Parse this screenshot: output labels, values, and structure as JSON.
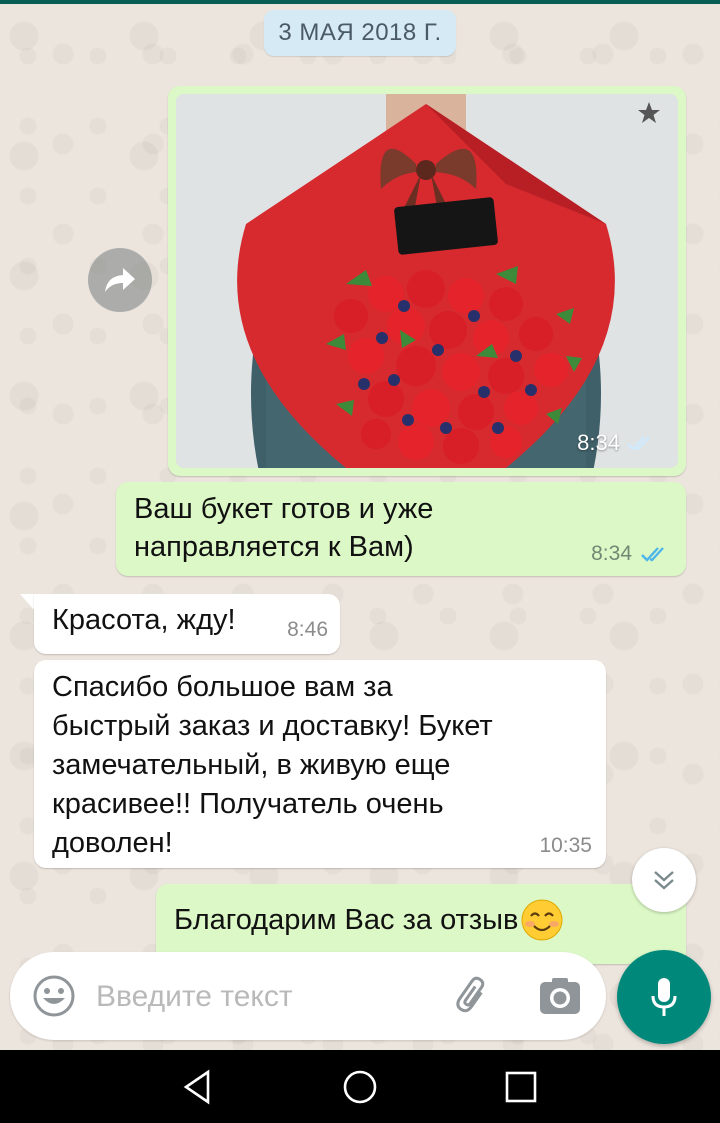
{
  "chat": {
    "date_label": "3 МАЯ 2018 Г.",
    "messages": [
      {
        "type": "image",
        "direction": "out",
        "time": "8:34",
        "status": "read"
      },
      {
        "type": "text",
        "direction": "out",
        "text_lines": [
          "Ваш букет готов и уже",
          "направляется к Вам)"
        ],
        "time": "8:34",
        "status": "read"
      },
      {
        "type": "text",
        "direction": "in",
        "text": "Красота, жду!",
        "time": "8:46"
      },
      {
        "type": "text",
        "direction": "in",
        "text_lines": [
          "Спасибо большое вам за",
          "быстрый заказ и доставку! Букет",
          "замечательный, в живую еще",
          "красивее!! Получатель очень",
          "доволен!"
        ],
        "time": "10:35"
      },
      {
        "type": "text",
        "direction": "out",
        "text": "Благодарим Вас за отзыв",
        "emoji": "smiling-face"
      }
    ]
  },
  "composer": {
    "placeholder": "Введите текст",
    "value": ""
  },
  "colors": {
    "outgoing_bubble": "#dcf8c6",
    "incoming_bubble": "#ffffff",
    "read_ticks": "#4fb6ec",
    "mic_button": "#00897b",
    "date_pill": "#d5eaf5"
  },
  "icons": [
    "forward-icon",
    "star-icon",
    "double-check-icon",
    "chevron-down-icon",
    "emoji-icon",
    "attach-icon",
    "camera-icon",
    "mic-icon",
    "back-icon",
    "home-icon",
    "recents-icon"
  ]
}
